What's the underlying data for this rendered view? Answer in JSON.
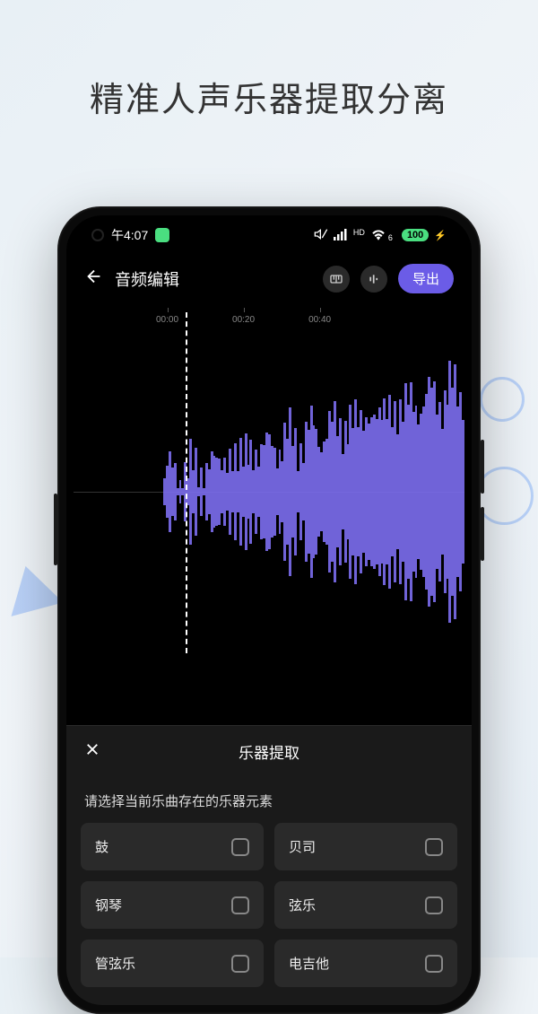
{
  "marketing": {
    "title": "精准人声乐器提取分离"
  },
  "status": {
    "time": "午4:07",
    "battery": "100",
    "hd_label": "HD",
    "wifi_sub": "6"
  },
  "header": {
    "title": "音频编辑",
    "export_label": "导出"
  },
  "timeline": {
    "t0": "00:00",
    "t1": "00:20",
    "t2": "00:40"
  },
  "sheet": {
    "title": "乐器提取",
    "subtitle": "请选择当前乐曲存在的乐器元素",
    "items": [
      {
        "label": "鼓"
      },
      {
        "label": "贝司"
      },
      {
        "label": "钢琴"
      },
      {
        "label": "弦乐"
      },
      {
        "label": "管弦乐"
      },
      {
        "label": "电吉他"
      }
    ]
  }
}
